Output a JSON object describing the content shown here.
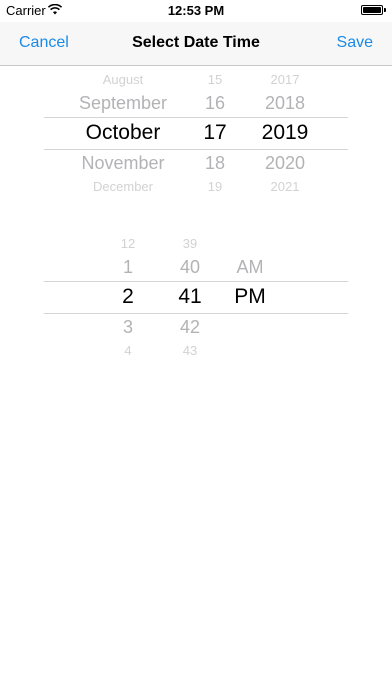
{
  "status_bar": {
    "carrier": "Carrier",
    "time": "12:53 PM",
    "icons": [
      "wifi-icon",
      "battery-icon"
    ]
  },
  "nav": {
    "cancel_label": "Cancel",
    "title": "Select Date Time",
    "save_label": "Save",
    "accent_color": "#1a8ae8"
  },
  "date_picker": {
    "months": [
      "August",
      "September",
      "October",
      "November",
      "December"
    ],
    "days": [
      "15",
      "16",
      "17",
      "18",
      "19"
    ],
    "years": [
      "2017",
      "2018",
      "2019",
      "2020",
      "2021"
    ],
    "selected": {
      "month": "October",
      "day": "17",
      "year": "2019"
    }
  },
  "time_picker": {
    "hours": [
      "12",
      "1",
      "2",
      "3",
      "4"
    ],
    "minutes": [
      "39",
      "40",
      "41",
      "42",
      "43"
    ],
    "periods": [
      "AM",
      "PM"
    ],
    "selected": {
      "hour": "2",
      "minute": "41",
      "period": "PM"
    }
  }
}
